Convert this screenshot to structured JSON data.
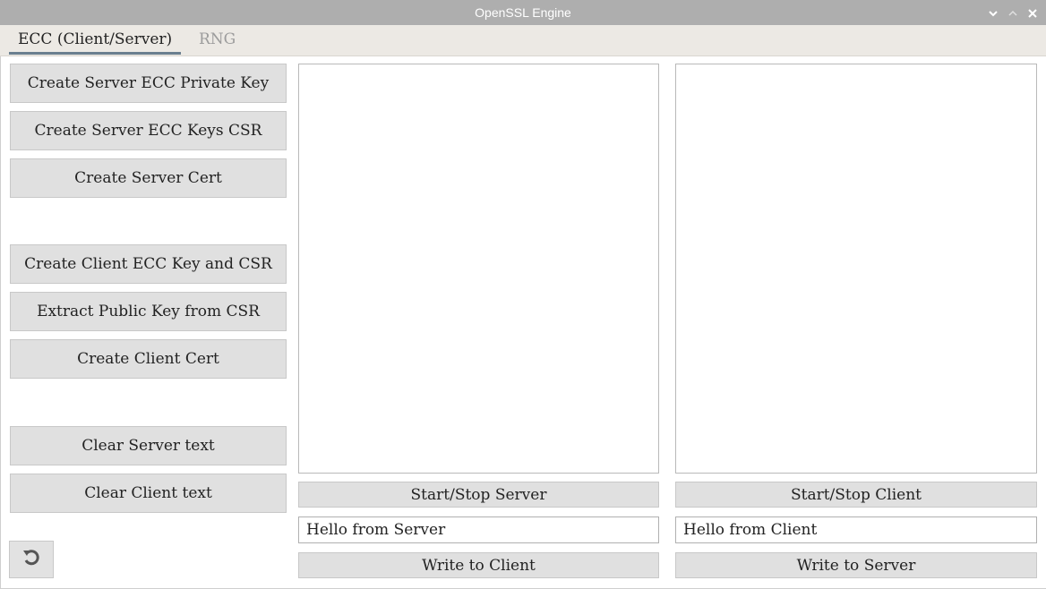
{
  "window": {
    "title": "OpenSSL Engine",
    "controls": [
      "chevron-down-icon",
      "chevron-up-icon",
      "close-icon"
    ]
  },
  "tabs": [
    {
      "label": "ECC (Client/Server)",
      "active": true
    },
    {
      "label": "RNG",
      "active": false
    }
  ],
  "sidebar": {
    "create_server_key": "Create Server ECC Private Key",
    "create_server_csr": "Create Server ECC Keys CSR",
    "create_server_cert": "Create Server Cert",
    "create_client_key_csr": "Create Client ECC Key and CSR",
    "extract_public_key": "Extract Public Key from CSR",
    "create_client_cert": "Create Client Cert",
    "clear_server_text": "Clear Server text",
    "clear_client_text": "Clear Client text",
    "reset_icon": "reset-icon"
  },
  "server": {
    "start_stop_label": "Start/Stop Server",
    "message_value": "Hello from Server",
    "write_label": "Write to Client"
  },
  "client": {
    "start_stop_label": "Start/Stop Client",
    "message_value": "Hello from Client",
    "write_label": "Write to Server"
  },
  "colors": {
    "titlebar": "#aeaeae",
    "tab_underline": "#6a7f8f",
    "button_bg": "#e0e0e0"
  }
}
